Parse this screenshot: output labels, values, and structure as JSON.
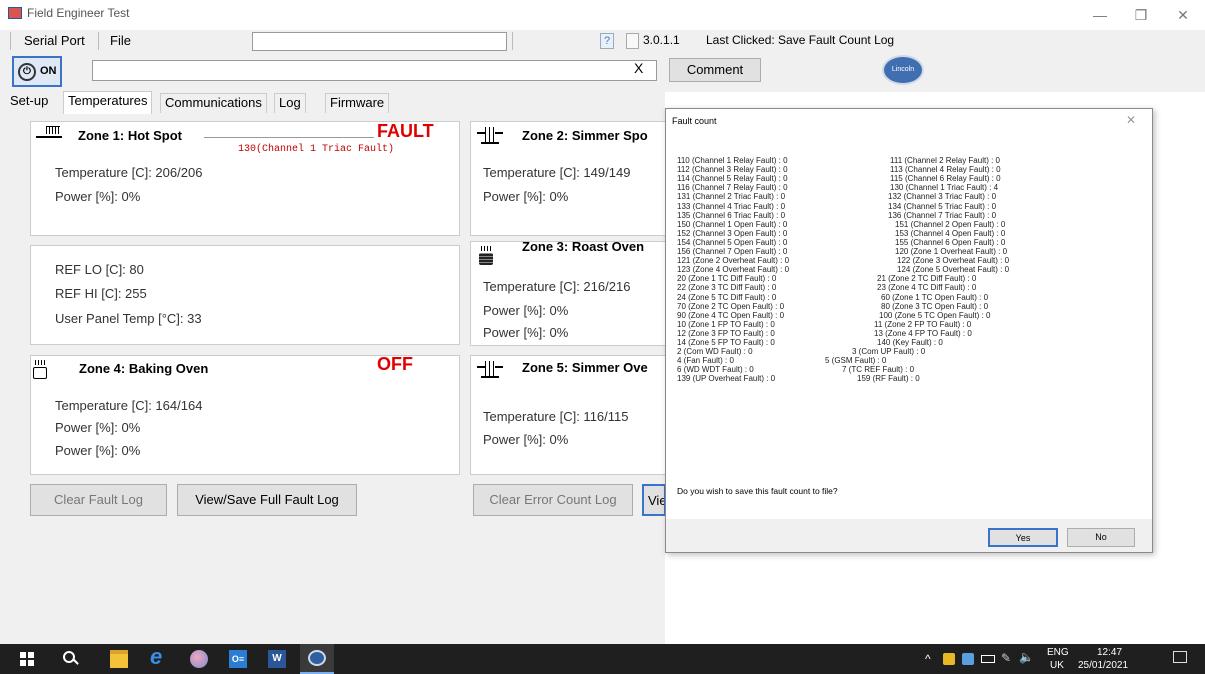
{
  "window": {
    "title": "Field Engineer Test",
    "minimize": "—",
    "restore": "❐",
    "close": "✕"
  },
  "menu": {
    "serial_port": "Serial Port",
    "file": "File",
    "help_icon": "?",
    "version": "3.0.1.1",
    "last_clicked": "Last Clicked: Save Fault Count Log"
  },
  "toolbar": {
    "on_label": "ON",
    "clear_x": "X",
    "comment": "Comment",
    "logo_text": "Lincoln"
  },
  "tabs": [
    "Set-up",
    "Temperatures",
    "Communications",
    "Log",
    "Firmware"
  ],
  "zone1": {
    "title": "Zone 1: Hot Spot",
    "status": "FAULT",
    "fault": "130(Channel 1 Triac Fault)",
    "temp": "Temperature [C]: 206/206",
    "power": "Power [%]: 0%"
  },
  "refs": {
    "lo": "REF LO [C]: 80",
    "hi": "REF HI [C]: 255",
    "panel": "User Panel Temp [°C]: 33"
  },
  "zone4": {
    "title": "Zone 4: Baking Oven",
    "status": "OFF",
    "temp": "Temperature [C]: 164/164",
    "power1": "Power [%]: 0%",
    "power2": "Power [%]: 0%"
  },
  "zone2": {
    "title": "Zone 2: Simmer Spo",
    "temp": "Temperature [C]: 149/149",
    "power": "Power [%]: 0%"
  },
  "zone3": {
    "title": "Zone 3: Roast Oven",
    "temp": "Temperature [C]: 216/216",
    "power1": "Power [%]: 0%",
    "power2": "Power [%]: 0%"
  },
  "zone5": {
    "title": "Zone 5: Simmer Ove",
    "temp": "Temperature [C]: 116/115",
    "power": "Power [%]: 0%"
  },
  "buttons": {
    "clear_fault_log": "Clear Fault Log",
    "view_save_full": "View/Save Full Fault Log",
    "clear_error_count": "Clear Error Count Log",
    "view_partial": "Vie"
  },
  "dialog": {
    "title": "Fault count",
    "close": "✕",
    "rows": [
      [
        "110 (Channel 1 Relay Fault) : 0",
        "111 (Channel 2 Relay Fault) : 0"
      ],
      [
        "112 (Channel 3 Relay Fault) : 0",
        "113 (Channel 4 Relay Fault) : 0"
      ],
      [
        "114 (Channel 5 Relay Fault) : 0",
        "115 (Channel 6 Relay Fault) : 0"
      ],
      [
        "116 (Channel 7 Relay Fault) : 0",
        "130 (Channel 1 Triac Fault) : 4"
      ],
      [
        "131 (Channel 2 Triac Fault) : 0",
        "132 (Channel 3 Triac Fault) : 0"
      ],
      [
        "133 (Channel 4 Triac Fault) : 0",
        "134 (Channel 5 Triac Fault) : 0"
      ],
      [
        "135 (Channel 6 Triac Fault) : 0",
        "136 (Channel 7 Triac Fault) : 0"
      ],
      [
        "150 (Channel 1 Open Fault) : 0",
        "151 (Channel 2 Open Fault) : 0"
      ],
      [
        "152 (Channel 3 Open Fault) : 0",
        "153 (Channel 4 Open Fault) : 0"
      ],
      [
        "154 (Channel 5 Open Fault) : 0",
        "155 (Channel 6 Open Fault) : 0"
      ],
      [
        "156 (Channel 7 Open Fault) : 0",
        "120 (Zone 1 Overheat Fault) : 0"
      ],
      [
        "121 (Zone 2 Overheat Fault) : 0",
        "122 (Zone 3 Overheat Fault) : 0"
      ],
      [
        "123 (Zone 4 Overheat Fault) : 0",
        "124 (Zone 5 Overheat Fault) : 0"
      ],
      [
        "20 (Zone 1 TC Diff Fault) : 0",
        "21 (Zone 2 TC Diff Fault) : 0"
      ],
      [
        "22 (Zone 3 TC Diff Fault) : 0",
        "23 (Zone 4 TC Diff Fault) : 0"
      ],
      [
        "24 (Zone 5 TC Diff Fault) : 0",
        "60 (Zone 1 TC Open Fault) : 0"
      ],
      [
        "70 (Zone 2 TC Open Fault) : 0",
        "80 (Zone 3 TC Open Fault) : 0"
      ],
      [
        "90 (Zone 4 TC Open Fault) : 0",
        "100 (Zone 5 TC Open Fault) : 0"
      ],
      [
        "10 (Zone 1 FP TO Fault) : 0",
        "11 (Zone 2 FP TO Fault) : 0"
      ],
      [
        "12 (Zone 3 FP TO Fault) : 0",
        "13 (Zone 4 FP TO Fault) : 0"
      ],
      [
        "14 (Zone 5 FP TO Fault) : 0",
        "140 (Key Fault) : 0"
      ],
      [
        "2 (Com WD Fault) : 0",
        "3 (Com UP Fault) : 0"
      ],
      [
        "4 (Fan Fault) : 0",
        "5 (GSM Fault) : 0"
      ],
      [
        "6 (WD WDT Fault) : 0",
        "7 (TC REF Fault) : 0"
      ],
      [
        "139 (UP Overheat Fault) : 0",
        "159 (RF Fault) : 0"
      ]
    ],
    "question": "Do you wish to save this fault count to file?",
    "yes": "Yes",
    "no": "No"
  },
  "taskbar": {
    "lang1": "ENG",
    "lang2": "UK",
    "time": "12:47",
    "date": "25/01/2021"
  }
}
